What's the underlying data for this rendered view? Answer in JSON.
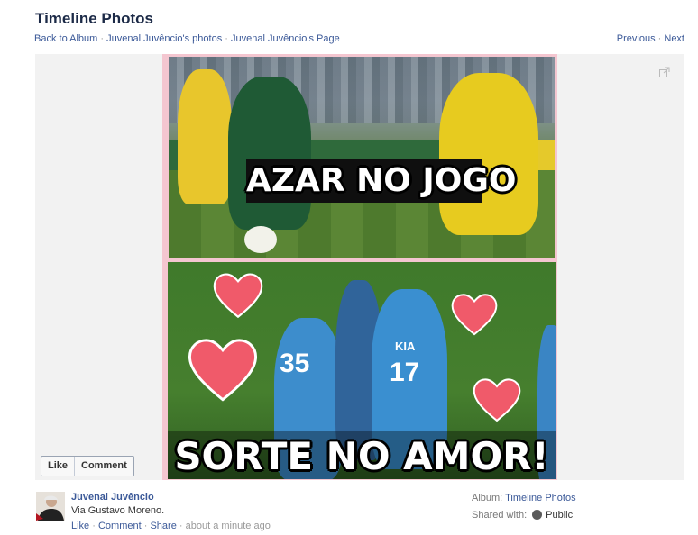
{
  "header": {
    "title": "Timeline Photos",
    "breadcrumbs": [
      "Back to Album",
      "Juvenal Juvêncio's photos",
      "Juvenal Juvêncio's Page"
    ],
    "separator": "·",
    "nav_previous": "Previous",
    "nav_next": "Next"
  },
  "photo": {
    "caption_top": "AZAR NO JOGO",
    "caption_bottom": "SORTE NO AMOR!",
    "jersey_left": "35",
    "jersey_right": "17",
    "sponsor": "KIA"
  },
  "like_bar": {
    "like_label": "Like",
    "comment_label": "Comment"
  },
  "post": {
    "author": "Juvenal Juvêncio",
    "description": "Via Gustavo Moreno.",
    "actions": [
      "Like",
      "Comment",
      "Share"
    ],
    "timestamp": "about a minute ago"
  },
  "meta": {
    "album_label": "Album:",
    "album_value": "Timeline Photos",
    "shared_label": "Shared with:",
    "shared_value": "Public"
  },
  "colors": {
    "link": "#3b5998",
    "title": "#1c2a47",
    "heart": "#f05a6a"
  }
}
